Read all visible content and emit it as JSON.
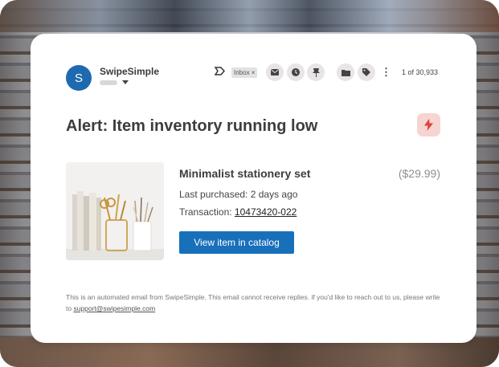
{
  "email": {
    "sender_initial": "S",
    "sender_name": "SwipeSimple",
    "inbox_chip": "Inbox ×",
    "counter": "1 of 30,933",
    "subject": "Alert: Item inventory running low"
  },
  "toolbar_icons": [
    "label-icon",
    "mail-icon",
    "clock-icon",
    "pin-icon",
    "folder-icon",
    "tag-icon",
    "more-vert-icon"
  ],
  "product": {
    "name": "Minimalist stationery set",
    "price": "($29.99)",
    "last_purchased": "Last purchased: 2 days ago",
    "transaction_label": "Transaction: ",
    "transaction_id": "10473420-022",
    "cta_label": "View item in catalog"
  },
  "footer": {
    "text": "This is an automated email from SwipeSimple. This email cannot receive replies. if you'd like to reach out to us, please write to ",
    "email": "support@swipesimple.com"
  },
  "colors": {
    "accent": "#1870bb",
    "avatar": "#1e6ab0",
    "flash_bg": "#f6d4d2",
    "flash_icon": "#e0413a"
  }
}
